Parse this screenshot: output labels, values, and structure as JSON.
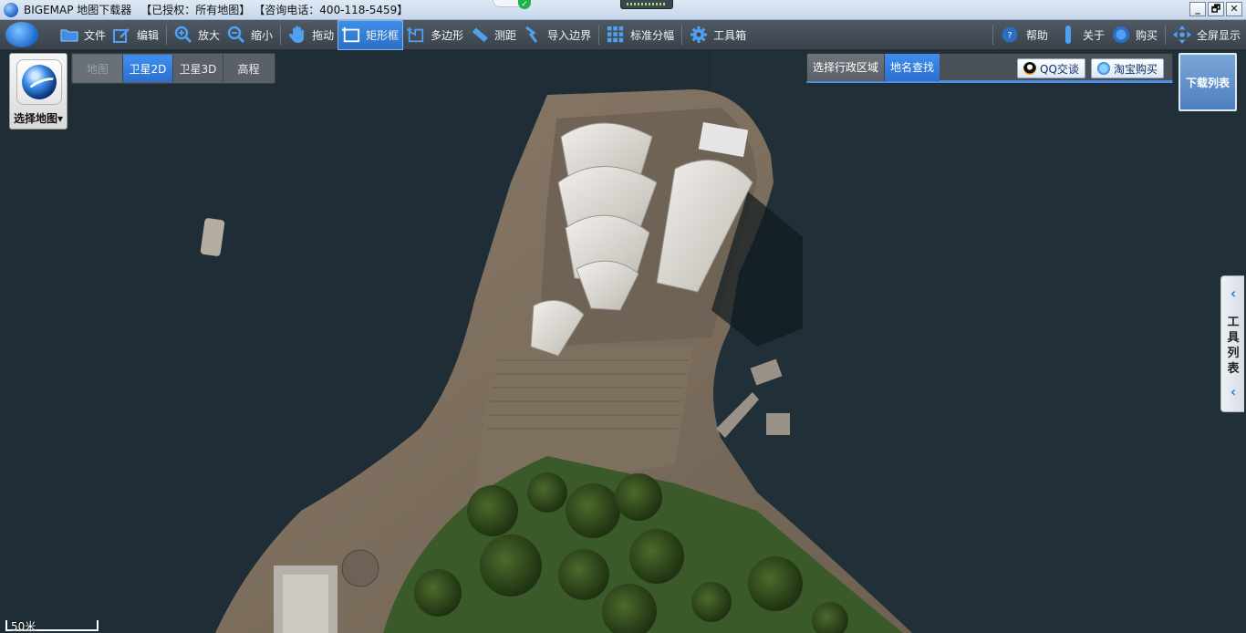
{
  "window": {
    "app_name": "BIGEMAP 地图下载器",
    "license": "【已授权：所有地图】",
    "phone": "【咨询电话：400-118-5459】",
    "controls": [
      "_",
      "🗗",
      "✕"
    ]
  },
  "toolbar": {
    "items": [
      {
        "id": "file",
        "label": "文件",
        "icon": "folder-icon"
      },
      {
        "id": "edit",
        "label": "编辑",
        "icon": "edit-icon"
      },
      {
        "id": "zoom-in",
        "label": "放大",
        "icon": "zoom-in-icon"
      },
      {
        "id": "zoom-out",
        "label": "缩小",
        "icon": "zoom-out-icon"
      },
      {
        "id": "pan",
        "label": "拖动",
        "icon": "hand-icon"
      },
      {
        "id": "rect",
        "label": "矩形框",
        "icon": "rectangle-icon",
        "active": true
      },
      {
        "id": "polygon",
        "label": "多边形",
        "icon": "polygon-icon"
      },
      {
        "id": "measure",
        "label": "测距",
        "icon": "ruler-icon"
      },
      {
        "id": "import",
        "label": "导入边界",
        "icon": "import-icon"
      },
      {
        "id": "grid",
        "label": "标准分幅",
        "icon": "grid-icon"
      },
      {
        "id": "tools",
        "label": "工具箱",
        "icon": "gear-icon"
      }
    ],
    "right_items": [
      {
        "id": "help",
        "label": "帮助",
        "icon": "help-icon"
      },
      {
        "id": "about",
        "label": "关于",
        "icon": "info-icon"
      },
      {
        "id": "buy",
        "label": "购买",
        "icon": "globe-icon"
      },
      {
        "id": "fullscreen",
        "label": "全屏显示",
        "icon": "fullscreen-icon"
      }
    ]
  },
  "select_map": {
    "label": "选择地图▾"
  },
  "map_types": [
    {
      "label": "地图",
      "state": "disabled"
    },
    {
      "label": "卫星2D",
      "state": "active"
    },
    {
      "label": "卫星3D",
      "state": "normal"
    },
    {
      "label": "高程",
      "state": "normal"
    }
  ],
  "search_panel": {
    "tabs": [
      {
        "label": "选择行政区域",
        "state": "inactive"
      },
      {
        "label": "地名查找",
        "state": "active"
      }
    ],
    "qq_label": "QQ交谈",
    "taobao_label": "淘宝购买"
  },
  "download_list": {
    "label": "下载列表"
  },
  "tool_list": {
    "label": "工具列表"
  },
  "scale": {
    "label": "50米"
  },
  "colors": {
    "accent": "#3f8ff0",
    "toolbar": "#444d56",
    "water": "#1d2b33"
  }
}
